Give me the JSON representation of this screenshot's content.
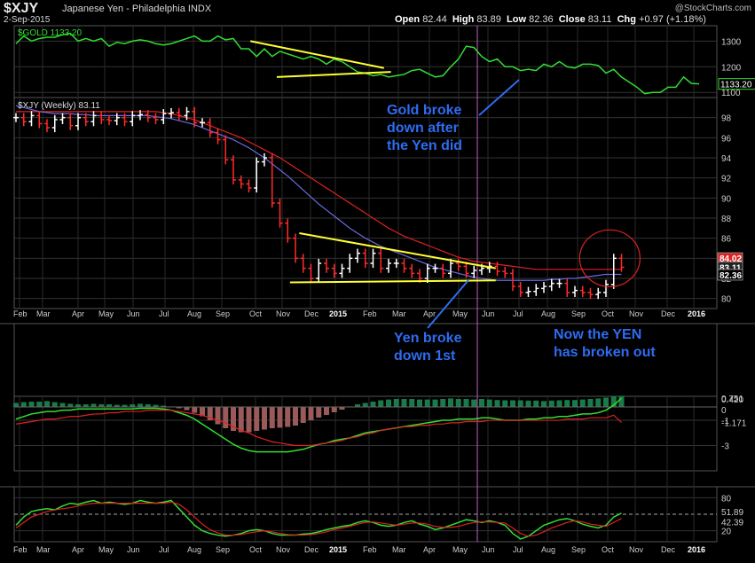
{
  "header": {
    "symbol": "$XJY",
    "name": "Japanese Yen - Philadelphia",
    "exchange": "INDX",
    "date": "2-Sep-2015",
    "open_label": "Open",
    "open": "82.44",
    "high_label": "High",
    "high": "83.89",
    "low_label": "Low",
    "low": "82.36",
    "close_label": "Close",
    "close": "83.11",
    "chg_label": "Chg",
    "chg": "+0.97 (+1.18%)",
    "watermark": "@StockCharts.com"
  },
  "colors": {
    "background": "#000000",
    "price_bars": "#ffffff",
    "down_bars": "#ff2a2a",
    "gold_line": "#33dd33",
    "ma_red": "#dd2222",
    "ma_blue": "#6a6ae0",
    "trendline": "#ffff33",
    "annotation": "#2e6cf0",
    "hist_pos": "#1a7a4a",
    "hist_neg": "#9a5a5a"
  },
  "annotations": {
    "gold": "Gold broke\ndown after\nthe Yen did",
    "yen": "Yen broke\ndown 1st",
    "breakout": "Now the YEN\nhas broken out"
  },
  "chart_data": [
    {
      "type": "line",
      "name": "gold",
      "legend": "$GOLD 1133.20",
      "last_label": "1133.20",
      "ylim": [
        1080,
        1360
      ],
      "y_ticks": [
        "1300",
        "1200",
        "1100"
      ],
      "y_tick_values": [
        1300,
        1200,
        1100
      ],
      "values": [
        1290,
        1320,
        1300,
        1310,
        1315,
        1315,
        1325,
        1330,
        1300,
        1310,
        1300,
        1310,
        1280,
        1295,
        1290,
        1300,
        1305,
        1300,
        1290,
        1285,
        1290,
        1300,
        1310,
        1320,
        1300,
        1300,
        1320,
        1305,
        1310,
        1270,
        1270,
        1240,
        1270,
        1240,
        1260,
        1250,
        1240,
        1230,
        1240,
        1230,
        1210,
        1230,
        1220,
        1200,
        1180,
        1175,
        1165,
        1170,
        1160,
        1165,
        1170,
        1185,
        1190,
        1175,
        1160,
        1165,
        1200,
        1230,
        1280,
        1275,
        1240,
        1220,
        1230,
        1200,
        1200,
        1185,
        1190,
        1185,
        1210,
        1200,
        1220,
        1200,
        1195,
        1210,
        1210,
        1205,
        1175,
        1190,
        1160,
        1140,
        1120,
        1095,
        1100,
        1100,
        1120,
        1120,
        1160,
        1135,
        1133
      ],
      "trendlines": [
        {
          "from": [
            30.2,
            1300
          ],
          "to": [
            47.4,
            1195
          ]
        },
        {
          "from": [
            33.6,
            1160
          ],
          "to": [
            48.3,
            1180
          ]
        }
      ]
    },
    {
      "type": "ohlc",
      "name": "$XJY (Weekly) 83.11",
      "ylim": [
        79,
        100
      ],
      "y_ticks": [
        "98",
        "96",
        "94",
        "92",
        "90",
        "88",
        "86",
        "84",
        "82",
        "80"
      ],
      "y_tick_values": [
        98,
        96,
        94,
        92,
        90,
        88,
        86,
        84,
        82,
        80
      ],
      "last_labels": [
        "84.02",
        "83.11",
        "82.36"
      ],
      "x_ticks": [
        "Feb",
        "Mar",
        "Apr",
        "May",
        "Jun",
        "Jul",
        "Aug",
        "Sep",
        "Oct",
        "Nov",
        "Dec",
        "2015",
        "Feb",
        "Mar",
        "Apr",
        "May",
        "Jun",
        "Jul",
        "Aug",
        "Sep",
        "Oct",
        "Nov",
        "Dec",
        "2016"
      ],
      "close": [
        98.0,
        97.6,
        98.2,
        97.4,
        97.0,
        97.8,
        98.0,
        97.2,
        98.0,
        97.6,
        98.2,
        97.8,
        97.7,
        98.0,
        97.6,
        98.2,
        98.3,
        98.0,
        97.8,
        98.4,
        98.5,
        98.2,
        98.6,
        97.5,
        97.5,
        96.5,
        95.8,
        93.8,
        91.8,
        91.4,
        91.0,
        93.6,
        94.0,
        89.5,
        87.5,
        86.0,
        84.0,
        83.0,
        82.0,
        83.5,
        83.0,
        82.5,
        83.0,
        84.0,
        84.5,
        83.5,
        84.5,
        83.0,
        83.5,
        83.5,
        83.0,
        82.5,
        82.0,
        83.0,
        83.0,
        82.5,
        83.5,
        83.2,
        82.5,
        82.8,
        83.0,
        83.2,
        82.7,
        82.5,
        81.2,
        80.6,
        80.7,
        81.0,
        81.2,
        81.5,
        81.5,
        80.6,
        80.8,
        80.6,
        80.4,
        80.6,
        81.4,
        84.0,
        83.1
      ],
      "ma_red": [
        98.6,
        98.6,
        98.6,
        98.6,
        98.6,
        98.6,
        98.6,
        98.6,
        98.6,
        98.6,
        98.6,
        98.6,
        98.6,
        98.6,
        98.6,
        98.6,
        98.6,
        98.6,
        98.6,
        98.5,
        98.4,
        98.2,
        98.0,
        97.8,
        97.5,
        97.2,
        96.9,
        96.6,
        96.3,
        96.0,
        95.6,
        95.2,
        94.8,
        94.4,
        94.0,
        93.5,
        93.0,
        92.5,
        92.0,
        91.5,
        91.0,
        90.5,
        90.0,
        89.5,
        89.0,
        88.5,
        88.0,
        87.5,
        87.0,
        86.6,
        86.2,
        85.9,
        85.6,
        85.3,
        85.0,
        84.7,
        84.4,
        84.1,
        83.9,
        83.7,
        83.6,
        83.5,
        83.4,
        83.3,
        83.2,
        83.1,
        83.0,
        82.9,
        82.9,
        82.9,
        82.9,
        82.9,
        82.9,
        82.9,
        82.9,
        82.9,
        82.9,
        82.9,
        82.9
      ],
      "ma_blue": [
        99.2,
        99.0,
        98.8,
        98.6,
        98.5,
        98.4,
        98.4,
        98.4,
        98.3,
        98.3,
        98.2,
        98.2,
        98.2,
        98.2,
        98.2,
        98.2,
        98.2,
        98.2,
        98.1,
        98.0,
        97.9,
        97.7,
        97.5,
        97.3,
        97.0,
        96.7,
        96.4,
        96.1,
        95.8,
        95.4,
        95.0,
        94.5,
        94.0,
        93.4,
        92.8,
        92.2,
        91.5,
        90.8,
        90.1,
        89.4,
        88.8,
        88.2,
        87.6,
        87.0,
        86.5,
        86.0,
        85.6,
        85.2,
        84.9,
        84.6,
        84.3,
        84.0,
        83.7,
        83.4,
        83.1,
        82.9,
        82.7,
        82.5,
        82.3,
        82.1,
        82.0,
        81.9,
        81.8,
        81.8,
        81.8,
        81.8,
        81.8,
        81.8,
        81.8,
        81.9,
        81.9,
        82.0,
        82.0,
        82.1,
        82.2,
        82.3,
        82.4,
        82.4,
        82.4
      ],
      "trendlines": [
        {
          "from": [
            36.5,
            86.5
          ],
          "to": [
            61.8,
            83.0
          ]
        },
        {
          "from": [
            35.3,
            81.6
          ],
          "to": [
            61.8,
            81.8
          ]
        }
      ],
      "circle": {
        "x": 76.5,
        "y": 84.0
      }
    },
    {
      "type": "bar",
      "name": "macd_histogram",
      "ylim": [
        -5,
        0.9
      ],
      "values": [
        0.15,
        0.18,
        0.2,
        0.2,
        0.22,
        0.18,
        0.15,
        0.12,
        0.1,
        0.1,
        0.12,
        0.1,
        0.1,
        0.08,
        0.08,
        0.1,
        0.12,
        0.1,
        0.08,
        0.05,
        0.02,
        -0.05,
        -0.12,
        -0.22,
        -0.35,
        -0.5,
        -0.65,
        -0.8,
        -0.9,
        -0.95,
        -0.95,
        -0.9,
        -0.85,
        -0.8,
        -0.78,
        -0.75,
        -0.7,
        -0.6,
        -0.5,
        -0.4,
        -0.3,
        -0.2,
        -0.1,
        0.02,
        0.1,
        0.15,
        0.2,
        0.25,
        0.28,
        0.3,
        0.3,
        0.3,
        0.28,
        0.28,
        0.28,
        0.3,
        0.32,
        0.3,
        0.3,
        0.28,
        0.3,
        0.28,
        0.26,
        0.25,
        0.25,
        0.25,
        0.24,
        0.24,
        0.22,
        0.24,
        0.25,
        0.26,
        0.26,
        0.28,
        0.3,
        0.32,
        0.35,
        0.4,
        0.42
      ],
      "labels": [
        "0.420",
        "0"
      ]
    },
    {
      "type": "line",
      "name": "macd",
      "ylim": [
        -5,
        0.9
      ],
      "y_ticks": [
        "-1",
        "-3"
      ],
      "y_tick_values": [
        -1,
        -3
      ],
      "last_labels": [
        "0.751",
        "-1.171"
      ],
      "macd": [
        -0.9,
        -0.7,
        -0.5,
        -0.4,
        -0.3,
        -0.3,
        -0.2,
        -0.2,
        -0.1,
        -0.1,
        -0.1,
        -0.1,
        -0.1,
        -0.1,
        -0.1,
        -0.1,
        -0.05,
        -0.05,
        -0.05,
        -0.1,
        -0.2,
        -0.4,
        -0.6,
        -0.9,
        -1.3,
        -1.7,
        -2.1,
        -2.5,
        -2.9,
        -3.2,
        -3.4,
        -3.5,
        -3.5,
        -3.5,
        -3.5,
        -3.5,
        -3.4,
        -3.3,
        -3.1,
        -2.9,
        -2.8,
        -2.6,
        -2.5,
        -2.4,
        -2.2,
        -2.0,
        -1.9,
        -1.8,
        -1.7,
        -1.6,
        -1.5,
        -1.4,
        -1.3,
        -1.2,
        -1.1,
        -1.0,
        -1.0,
        -0.9,
        -0.9,
        -0.9,
        -0.8,
        -0.8,
        -0.9,
        -1.0,
        -1.0,
        -1.0,
        -0.9,
        -0.9,
        -0.8,
        -0.8,
        -0.7,
        -0.7,
        -0.6,
        -0.5,
        -0.5,
        -0.4,
        -0.2,
        0.2,
        0.751
      ],
      "signal": [
        -1.3,
        -1.2,
        -1.1,
        -1.0,
        -0.9,
        -0.9,
        -0.8,
        -0.7,
        -0.7,
        -0.6,
        -0.5,
        -0.5,
        -0.4,
        -0.4,
        -0.3,
        -0.3,
        -0.3,
        -0.2,
        -0.2,
        -0.2,
        -0.2,
        -0.3,
        -0.4,
        -0.5,
        -0.6,
        -0.8,
        -1.0,
        -1.2,
        -1.5,
        -1.8,
        -2.0,
        -2.3,
        -2.5,
        -2.7,
        -2.8,
        -2.9,
        -3.0,
        -3.0,
        -3.0,
        -2.9,
        -2.8,
        -2.7,
        -2.6,
        -2.4,
        -2.3,
        -2.1,
        -2.0,
        -1.8,
        -1.7,
        -1.6,
        -1.5,
        -1.5,
        -1.4,
        -1.4,
        -1.3,
        -1.3,
        -1.2,
        -1.2,
        -1.1,
        -1.1,
        -1.1,
        -1.0,
        -1.0,
        -1.0,
        -1.0,
        -1.0,
        -1.0,
        -1.0,
        -1.0,
        -1.0,
        -1.0,
        -0.9,
        -0.9,
        -0.9,
        -0.8,
        -0.8,
        -0.8,
        -0.6,
        -1.171
      ]
    },
    {
      "type": "line",
      "name": "stochastic",
      "ylim": [
        0,
        100
      ],
      "y_ticks": [
        "80",
        "20"
      ],
      "y_tick_values": [
        80,
        20
      ],
      "last_labels": [
        "51.89",
        "42.39"
      ],
      "k": [
        30,
        45,
        55,
        58,
        60,
        58,
        65,
        70,
        68,
        72,
        75,
        70,
        72,
        70,
        68,
        70,
        75,
        72,
        70,
        72,
        75,
        60,
        45,
        30,
        20,
        15,
        12,
        10,
        12,
        15,
        20,
        22,
        20,
        15,
        12,
        12,
        12,
        14,
        15,
        18,
        22,
        25,
        28,
        30,
        35,
        38,
        35,
        30,
        28,
        30,
        35,
        38,
        32,
        28,
        22,
        25,
        30,
        35,
        40,
        38,
        35,
        38,
        35,
        30,
        15,
        5,
        10,
        20,
        30,
        35,
        40,
        42,
        38,
        32,
        28,
        25,
        30,
        45,
        51.89
      ],
      "d": [
        25,
        35,
        45,
        50,
        55,
        58,
        60,
        62,
        65,
        68,
        70,
        70,
        70,
        70,
        70,
        70,
        70,
        70,
        70,
        70,
        72,
        68,
        58,
        45,
        32,
        22,
        16,
        12,
        12,
        13,
        16,
        18,
        20,
        18,
        15,
        13,
        12,
        12,
        13,
        15,
        18,
        22,
        25,
        28,
        32,
        35,
        36,
        34,
        32,
        30,
        32,
        34,
        34,
        32,
        28,
        26,
        26,
        28,
        32,
        35,
        36,
        36,
        35,
        34,
        25,
        15,
        10,
        12,
        18,
        25,
        30,
        35,
        38,
        36,
        32,
        30,
        28,
        35,
        42.39
      ]
    }
  ]
}
